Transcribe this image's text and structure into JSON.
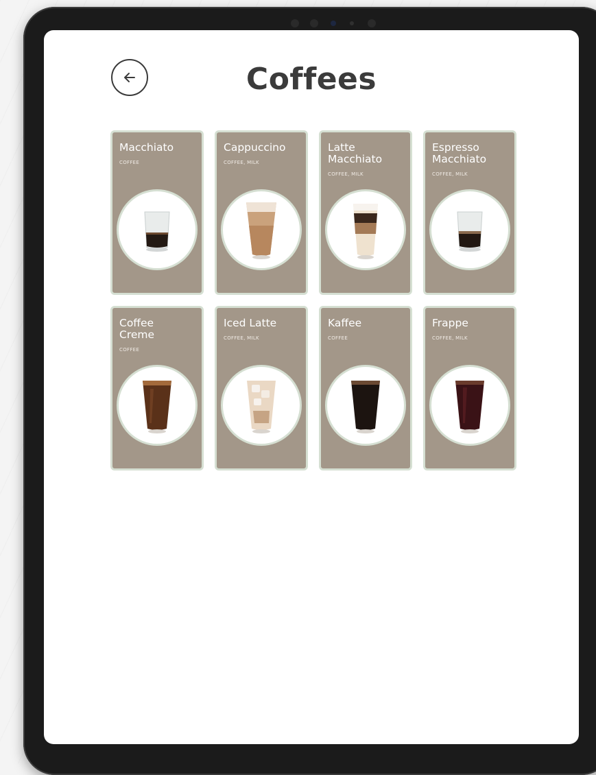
{
  "header": {
    "title": "Coffees",
    "back_icon": "arrow-left-icon"
  },
  "drinks": [
    {
      "name": "Macchiato",
      "tags": "COFFEE"
    },
    {
      "name": "Cappuccino",
      "tags": "COFFEE, MILK"
    },
    {
      "name": "Latte\nMacchiato",
      "tags": "COFFEE, MILK"
    },
    {
      "name": "Espresso\nMacchiato",
      "tags": "COFFEE, MILK"
    },
    {
      "name": "Coffee\nCreme",
      "tags": "COFFEE"
    },
    {
      "name": "Iced Latte",
      "tags": "COFFEE, MILK"
    },
    {
      "name": "Kaffee",
      "tags": "COFFEE"
    },
    {
      "name": "Frappe",
      "tags": "COFFEE, MILK"
    }
  ],
  "colors": {
    "card_bg": "#a39789",
    "card_border": "#d5dfd2",
    "title": "#3b3b3b"
  }
}
